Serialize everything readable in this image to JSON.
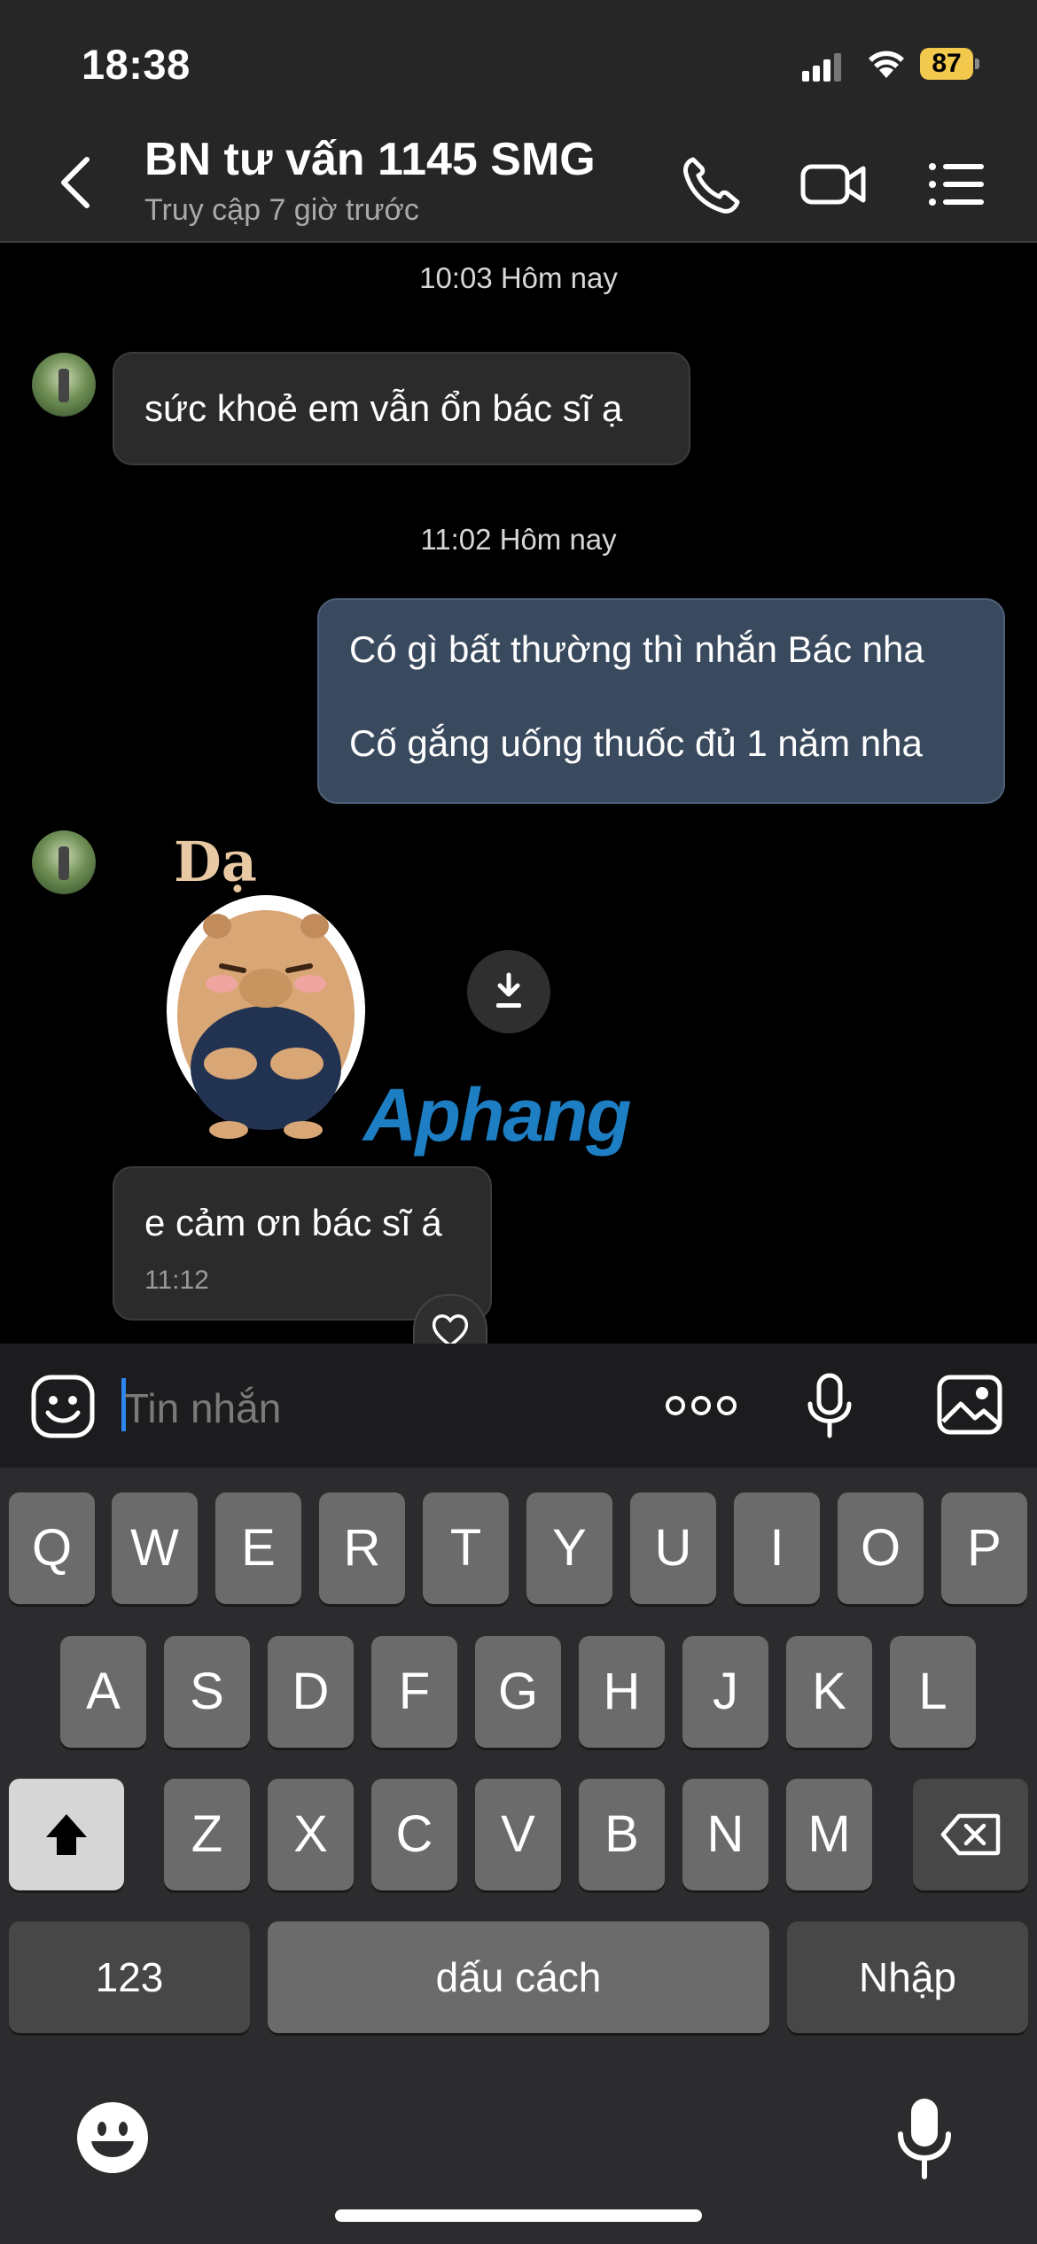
{
  "status_bar": {
    "time": "18:38",
    "battery": "87"
  },
  "header": {
    "title": "BN tư vấn 1145 SMG",
    "subtitle": "Truy cập 7 giờ trước",
    "icons": [
      "back-chevron-icon",
      "phone-icon",
      "video-call-icon",
      "menu-list-icon"
    ]
  },
  "chat": {
    "timestamp_1": "10:03 Hôm nay",
    "msg_1": "sức khoẻ em vẫn ổn bác sĩ ạ",
    "timestamp_2": "11:02 Hôm nay",
    "msg_2_line_1": "Có gì bất thường thì nhắn Bác nha",
    "msg_2_line_2": "Cố gắng uống thuốc đủ 1 năm nha",
    "sticker_caption": "Dạ",
    "sticker_watermark": "Aphang",
    "msg_3": "e cảm ơn bác sĩ á",
    "msg_3_time": "11:12"
  },
  "input": {
    "placeholder": "Tin nhắn"
  },
  "keyboard": {
    "row1": [
      "Q",
      "W",
      "E",
      "R",
      "T",
      "Y",
      "U",
      "I",
      "O",
      "P"
    ],
    "row2": [
      "A",
      "S",
      "D",
      "F",
      "G",
      "H",
      "J",
      "K",
      "L"
    ],
    "row3": [
      "Z",
      "X",
      "C",
      "V",
      "B",
      "N",
      "M"
    ],
    "numbers": "123",
    "space": "dấu cách",
    "return": "Nhập"
  }
}
